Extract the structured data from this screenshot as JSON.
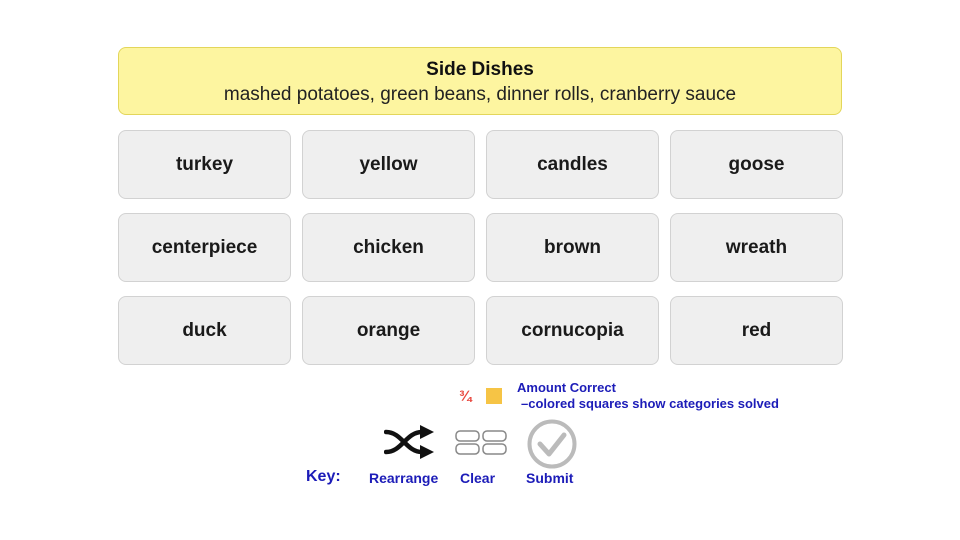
{
  "solved_group": {
    "title": "Side Dishes",
    "members": "mashed potatoes, green beans, dinner rolls, cranberry sauce",
    "color": "#fdf5a0"
  },
  "tiles": [
    "turkey",
    "yellow",
    "candles",
    "goose",
    "centerpiece",
    "chicken",
    "brown",
    "wreath",
    "duck",
    "orange",
    "cornucopia",
    "red"
  ],
  "amount_correct": {
    "fraction": "¾",
    "square_color": "#f6c445",
    "label": "Amount Correct",
    "description": "–colored squares show categories solved"
  },
  "key": {
    "label": "Key:",
    "rearrange": "Rearrange",
    "clear": "Clear",
    "submit": "Submit"
  },
  "icons": {
    "rearrange": "shuffle-icon",
    "clear": "grid-clear-icon",
    "submit": "check-circle-icon"
  }
}
